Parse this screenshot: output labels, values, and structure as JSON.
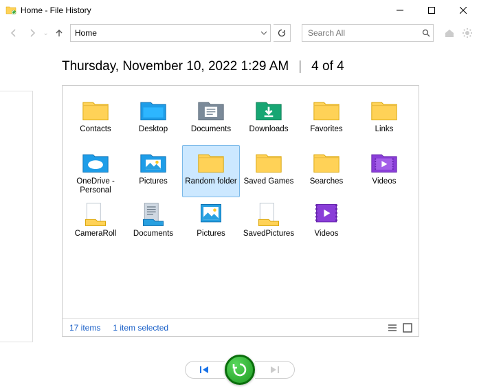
{
  "titlebar": {
    "title": "Home - File History"
  },
  "nav": {
    "address": "Home",
    "search_placeholder": "Search All"
  },
  "heading": {
    "timestamp": "Thursday, November 10, 2022 1:29 AM",
    "position": "4 of 4"
  },
  "items": [
    {
      "label": "Contacts",
      "icon": "folder-yellow"
    },
    {
      "label": "Desktop",
      "icon": "folder-blue"
    },
    {
      "label": "Documents",
      "icon": "folder-docs"
    },
    {
      "label": "Downloads",
      "icon": "folder-downloads"
    },
    {
      "label": "Favorites",
      "icon": "folder-yellow"
    },
    {
      "label": "Links",
      "icon": "folder-yellow"
    },
    {
      "label": "OneDrive - Personal",
      "icon": "folder-onedrive"
    },
    {
      "label": "Pictures",
      "icon": "folder-pictures"
    },
    {
      "label": "Random folder",
      "icon": "folder-yellow",
      "selected": true
    },
    {
      "label": "Saved Games",
      "icon": "folder-yellow"
    },
    {
      "label": "Searches",
      "icon": "folder-yellow"
    },
    {
      "label": "Videos",
      "icon": "folder-videos"
    },
    {
      "label": "CameraRoll",
      "icon": "lib-camera"
    },
    {
      "label": "Documents",
      "icon": "lib-docs"
    },
    {
      "label": "Pictures",
      "icon": "lib-pictures"
    },
    {
      "label": "SavedPictures",
      "icon": "lib-saved"
    },
    {
      "label": "Videos",
      "icon": "lib-videos"
    }
  ],
  "status": {
    "count": "17 items",
    "selection": "1 item selected"
  }
}
